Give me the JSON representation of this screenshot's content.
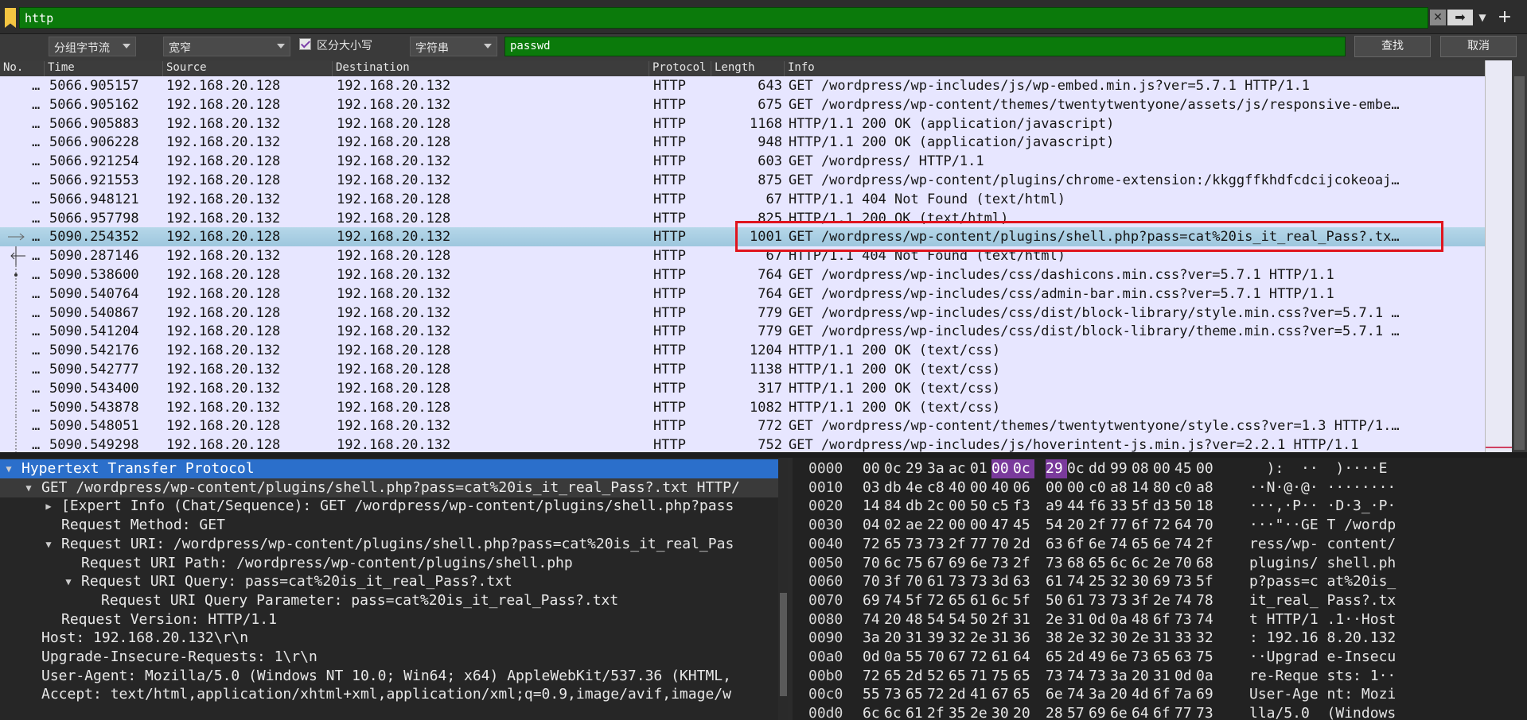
{
  "filter": {
    "value": "http"
  },
  "search": {
    "mode": "分组字节流",
    "charset": "宽窄",
    "case_label": "区分大小写",
    "type": "字符串",
    "value": "passwd",
    "find_label": "查找",
    "cancel_label": "取消"
  },
  "columns": [
    "No.",
    "Time",
    "Source",
    "Destination",
    "Protocol",
    "Length",
    "Info"
  ],
  "packets": [
    {
      "no": "…",
      "time": "5066.905157",
      "src": "192.168.20.128",
      "dst": "192.168.20.132",
      "proto": "HTTP",
      "len": "643",
      "info": "GET /wordpress/wp-includes/js/wp-embed.min.js?ver=5.7.1 HTTP/1.1"
    },
    {
      "no": "…",
      "time": "5066.905162",
      "src": "192.168.20.128",
      "dst": "192.168.20.132",
      "proto": "HTTP",
      "len": "675",
      "info": "GET /wordpress/wp-content/themes/twentytwentyone/assets/js/responsive-embe…"
    },
    {
      "no": "…",
      "time": "5066.905883",
      "src": "192.168.20.132",
      "dst": "192.168.20.128",
      "proto": "HTTP",
      "len": "1168",
      "info": "HTTP/1.1 200 OK  (application/javascript)"
    },
    {
      "no": "…",
      "time": "5066.906228",
      "src": "192.168.20.132",
      "dst": "192.168.20.128",
      "proto": "HTTP",
      "len": "948",
      "info": "HTTP/1.1 200 OK  (application/javascript)"
    },
    {
      "no": "…",
      "time": "5066.921254",
      "src": "192.168.20.128",
      "dst": "192.168.20.132",
      "proto": "HTTP",
      "len": "603",
      "info": "GET /wordpress/ HTTP/1.1"
    },
    {
      "no": "…",
      "time": "5066.921553",
      "src": "192.168.20.128",
      "dst": "192.168.20.132",
      "proto": "HTTP",
      "len": "875",
      "info": "GET /wordpress/wp-content/plugins/chrome-extension:/kkggffkhdfcdcijcokeoaj…"
    },
    {
      "no": "…",
      "time": "5066.948121",
      "src": "192.168.20.132",
      "dst": "192.168.20.128",
      "proto": "HTTP",
      "len": "67",
      "info": "HTTP/1.1 404 Not Found  (text/html)"
    },
    {
      "no": "…",
      "time": "5066.957798",
      "src": "192.168.20.132",
      "dst": "192.168.20.128",
      "proto": "HTTP",
      "len": "825",
      "info": "HTTP/1.1 200 OK  (text/html)"
    },
    {
      "no": "…",
      "time": "5090.254352",
      "src": "192.168.20.128",
      "dst": "192.168.20.132",
      "proto": "HTTP",
      "len": "1001",
      "info": "GET /wordpress/wp-content/plugins/shell.php?pass=cat%20is_it_real_Pass?.tx…"
    },
    {
      "no": "…",
      "time": "5090.287146",
      "src": "192.168.20.132",
      "dst": "192.168.20.128",
      "proto": "HTTP",
      "len": "67",
      "info": "HTTP/1.1 404 Not Found  (text/html)"
    },
    {
      "no": "…",
      "time": "5090.538600",
      "src": "192.168.20.128",
      "dst": "192.168.20.132",
      "proto": "HTTP",
      "len": "764",
      "info": "GET /wordpress/wp-includes/css/dashicons.min.css?ver=5.7.1 HTTP/1.1"
    },
    {
      "no": "…",
      "time": "5090.540764",
      "src": "192.168.20.128",
      "dst": "192.168.20.132",
      "proto": "HTTP",
      "len": "764",
      "info": "GET /wordpress/wp-includes/css/admin-bar.min.css?ver=5.7.1 HTTP/1.1"
    },
    {
      "no": "…",
      "time": "5090.540867",
      "src": "192.168.20.128",
      "dst": "192.168.20.132",
      "proto": "HTTP",
      "len": "779",
      "info": "GET /wordpress/wp-includes/css/dist/block-library/style.min.css?ver=5.7.1 …"
    },
    {
      "no": "…",
      "time": "5090.541204",
      "src": "192.168.20.128",
      "dst": "192.168.20.132",
      "proto": "HTTP",
      "len": "779",
      "info": "GET /wordpress/wp-includes/css/dist/block-library/theme.min.css?ver=5.7.1 …"
    },
    {
      "no": "…",
      "time": "5090.542176",
      "src": "192.168.20.132",
      "dst": "192.168.20.128",
      "proto": "HTTP",
      "len": "1204",
      "info": "HTTP/1.1 200 OK  (text/css)"
    },
    {
      "no": "…",
      "time": "5090.542777",
      "src": "192.168.20.132",
      "dst": "192.168.20.128",
      "proto": "HTTP",
      "len": "1138",
      "info": "HTTP/1.1 200 OK  (text/css)"
    },
    {
      "no": "…",
      "time": "5090.543400",
      "src": "192.168.20.132",
      "dst": "192.168.20.128",
      "proto": "HTTP",
      "len": "317",
      "info": "HTTP/1.1 200 OK  (text/css)"
    },
    {
      "no": "…",
      "time": "5090.543878",
      "src": "192.168.20.132",
      "dst": "192.168.20.128",
      "proto": "HTTP",
      "len": "1082",
      "info": "HTTP/1.1 200 OK  (text/css)"
    },
    {
      "no": "…",
      "time": "5090.548051",
      "src": "192.168.20.128",
      "dst": "192.168.20.132",
      "proto": "HTTP",
      "len": "772",
      "info": "GET /wordpress/wp-content/themes/twentytwentyone/style.css?ver=1.3 HTTP/1.…"
    },
    {
      "no": "…",
      "time": "5090.549298",
      "src": "192.168.20.128",
      "dst": "192.168.20.132",
      "proto": "HTTP",
      "len": "752",
      "info": "GET /wordpress/wp-includes/js/hoverintent-js.min.js?ver=2.2.1 HTTP/1.1"
    }
  ],
  "details": [
    {
      "text": "Hypertext Transfer Protocol",
      "twisty": "▼"
    },
    {
      "text": "GET /wordpress/wp-content/plugins/shell.php?pass=cat%20is_it_real_Pass?.txt HTTP/",
      "twisty": "▼"
    },
    {
      "text": "[Expert Info (Chat/Sequence): GET /wordpress/wp-content/plugins/shell.php?pass",
      "twisty": "▶"
    },
    {
      "text": "Request Method: GET",
      "twisty": ""
    },
    {
      "text": "Request URI: /wordpress/wp-content/plugins/shell.php?pass=cat%20is_it_real_Pas",
      "twisty": "▼"
    },
    {
      "text": "Request URI Path: /wordpress/wp-content/plugins/shell.php",
      "twisty": ""
    },
    {
      "text": "Request URI Query: pass=cat%20is_it_real_Pass?.txt",
      "twisty": "▼"
    },
    {
      "text": "Request URI Query Parameter: pass=cat%20is_it_real_Pass?.txt",
      "twisty": ""
    },
    {
      "text": "Request Version: HTTP/1.1",
      "twisty": ""
    },
    {
      "text": "Host: 192.168.20.132\\r\\n",
      "twisty": ""
    },
    {
      "text": "Upgrade-Insecure-Requests: 1\\r\\n",
      "twisty": ""
    },
    {
      "text": "User-Agent: Mozilla/5.0 (Windows NT 10.0; Win64; x64) AppleWebKit/537.36 (KHTML,",
      "twisty": ""
    },
    {
      "text": "Accept: text/html,application/xhtml+xml,application/xml;q=0.9,image/avif,image/w",
      "twisty": ""
    }
  ],
  "hex": [
    {
      "off": "0000",
      "b1": [
        "00",
        "0c",
        "29",
        "3a",
        "ac",
        "01",
        "00",
        "0c"
      ],
      "b2": [
        "29",
        "0c",
        "dd",
        "99",
        "08",
        "00",
        "45",
        "00"
      ],
      "a1": "  ):  ··",
      "a2": " )····E"
    },
    {
      "off": "0010",
      "b1": [
        "03",
        "db",
        "4e",
        "c8",
        "40",
        "00",
        "40",
        "06"
      ],
      "b2": [
        "00",
        "00",
        "c0",
        "a8",
        "14",
        "80",
        "c0",
        "a8"
      ],
      "a1": "··N·@·@·",
      "a2": "········"
    },
    {
      "off": "0020",
      "b1": [
        "14",
        "84",
        "db",
        "2c",
        "00",
        "50",
        "c5",
        "f3"
      ],
      "b2": [
        "a9",
        "44",
        "f6",
        "33",
        "5f",
        "d3",
        "50",
        "18"
      ],
      "a1": "···,·P··",
      "a2": "·D·3_·P·"
    },
    {
      "off": "0030",
      "b1": [
        "04",
        "02",
        "ae",
        "22",
        "00",
        "00",
        "47",
        "45"
      ],
      "b2": [
        "54",
        "20",
        "2f",
        "77",
        "6f",
        "72",
        "64",
        "70"
      ],
      "a1": "···\"··GE",
      "a2": "T /wordp"
    },
    {
      "off": "0040",
      "b1": [
        "72",
        "65",
        "73",
        "73",
        "2f",
        "77",
        "70",
        "2d"
      ],
      "b2": [
        "63",
        "6f",
        "6e",
        "74",
        "65",
        "6e",
        "74",
        "2f"
      ],
      "a1": "ress/wp-",
      "a2": "content/"
    },
    {
      "off": "0050",
      "b1": [
        "70",
        "6c",
        "75",
        "67",
        "69",
        "6e",
        "73",
        "2f"
      ],
      "b2": [
        "73",
        "68",
        "65",
        "6c",
        "6c",
        "2e",
        "70",
        "68"
      ],
      "a1": "plugins/",
      "a2": "shell.ph"
    },
    {
      "off": "0060",
      "b1": [
        "70",
        "3f",
        "70",
        "61",
        "73",
        "73",
        "3d",
        "63"
      ],
      "b2": [
        "61",
        "74",
        "25",
        "32",
        "30",
        "69",
        "73",
        "5f"
      ],
      "a1": "p?pass=c",
      "a2": "at%20is_"
    },
    {
      "off": "0070",
      "b1": [
        "69",
        "74",
        "5f",
        "72",
        "65",
        "61",
        "6c",
        "5f"
      ],
      "b2": [
        "50",
        "61",
        "73",
        "73",
        "3f",
        "2e",
        "74",
        "78"
      ],
      "a1": "it_real_",
      "a2": "Pass?.tx"
    },
    {
      "off": "0080",
      "b1": [
        "74",
        "20",
        "48",
        "54",
        "54",
        "50",
        "2f",
        "31"
      ],
      "b2": [
        "2e",
        "31",
        "0d",
        "0a",
        "48",
        "6f",
        "73",
        "74"
      ],
      "a1": "t HTTP/1",
      "a2": ".1··Host"
    },
    {
      "off": "0090",
      "b1": [
        "3a",
        "20",
        "31",
        "39",
        "32",
        "2e",
        "31",
        "36"
      ],
      "b2": [
        "38",
        "2e",
        "32",
        "30",
        "2e",
        "31",
        "33",
        "32"
      ],
      "a1": ": 192.16",
      "a2": "8.20.132"
    },
    {
      "off": "00a0",
      "b1": [
        "0d",
        "0a",
        "55",
        "70",
        "67",
        "72",
        "61",
        "64"
      ],
      "b2": [
        "65",
        "2d",
        "49",
        "6e",
        "73",
        "65",
        "63",
        "75"
      ],
      "a1": "··Upgrad",
      "a2": "e-Insecu"
    },
    {
      "off": "00b0",
      "b1": [
        "72",
        "65",
        "2d",
        "52",
        "65",
        "71",
        "75",
        "65"
      ],
      "b2": [
        "73",
        "74",
        "73",
        "3a",
        "20",
        "31",
        "0d",
        "0a"
      ],
      "a1": "re-Reque",
      "a2": "sts: 1··"
    },
    {
      "off": "00c0",
      "b1": [
        "55",
        "73",
        "65",
        "72",
        "2d",
        "41",
        "67",
        "65"
      ],
      "b2": [
        "6e",
        "74",
        "3a",
        "20",
        "4d",
        "6f",
        "7a",
        "69"
      ],
      "a1": "User-Age",
      "a2": "nt: Mozi"
    },
    {
      "off": "00d0",
      "b1": [
        "6c",
        "6c",
        "61",
        "2f",
        "35",
        "2e",
        "30",
        "20"
      ],
      "b2": [
        "28",
        "57",
        "69",
        "6e",
        "64",
        "6f",
        "77",
        "73"
      ],
      "a1": "lla/5.0 ",
      "a2": "(Windows"
    }
  ]
}
